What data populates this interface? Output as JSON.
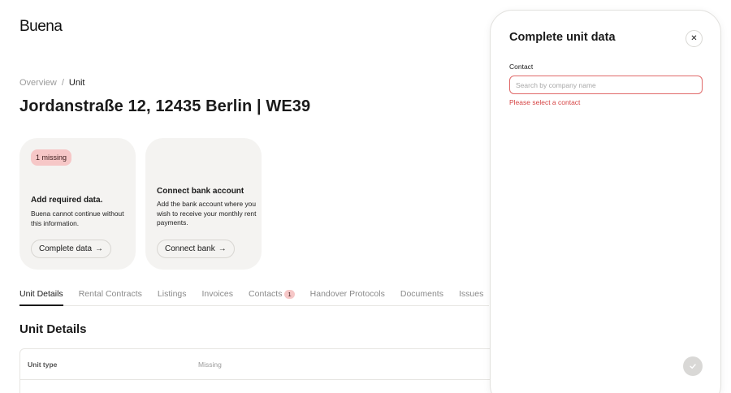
{
  "app": {
    "logo": "Buena"
  },
  "breadcrumb": {
    "items": [
      "Overview",
      "Unit"
    ],
    "separator": "/"
  },
  "page": {
    "title": "Jordanstraße 12, 12435 Berlin | WE39"
  },
  "cards": [
    {
      "badge": "1 missing",
      "title": "Add required data.",
      "description": "Buena cannot continue without this information.",
      "button_label": "Complete data",
      "button_icon": "→"
    },
    {
      "title": "Connect bank account",
      "description": "Add the bank account where you wish to receive your monthly rent payments.",
      "button_label": "Connect bank",
      "button_icon": "→"
    }
  ],
  "tabs": [
    {
      "label": "Unit Details",
      "active": true
    },
    {
      "label": "Rental Contracts"
    },
    {
      "label": "Listings"
    },
    {
      "label": "Invoices"
    },
    {
      "label": "Contacts",
      "count": "1"
    },
    {
      "label": "Handover Protocols"
    },
    {
      "label": "Documents"
    },
    {
      "label": "Issues"
    }
  ],
  "section": {
    "title": "Unit Details"
  },
  "table": {
    "rows": [
      {
        "label": "Unit type",
        "value": "Missing"
      }
    ]
  },
  "panel": {
    "title": "Complete unit data",
    "close_icon": "✕",
    "field_label": "Contact",
    "search_placeholder": "Search by company name",
    "search_value": "",
    "error": "Please select a contact",
    "confirm_icon": "check-icon"
  },
  "colors": {
    "error": "#d64545",
    "badge_bg": "#f6c7c7",
    "card_bg": "#f4f3f1"
  }
}
